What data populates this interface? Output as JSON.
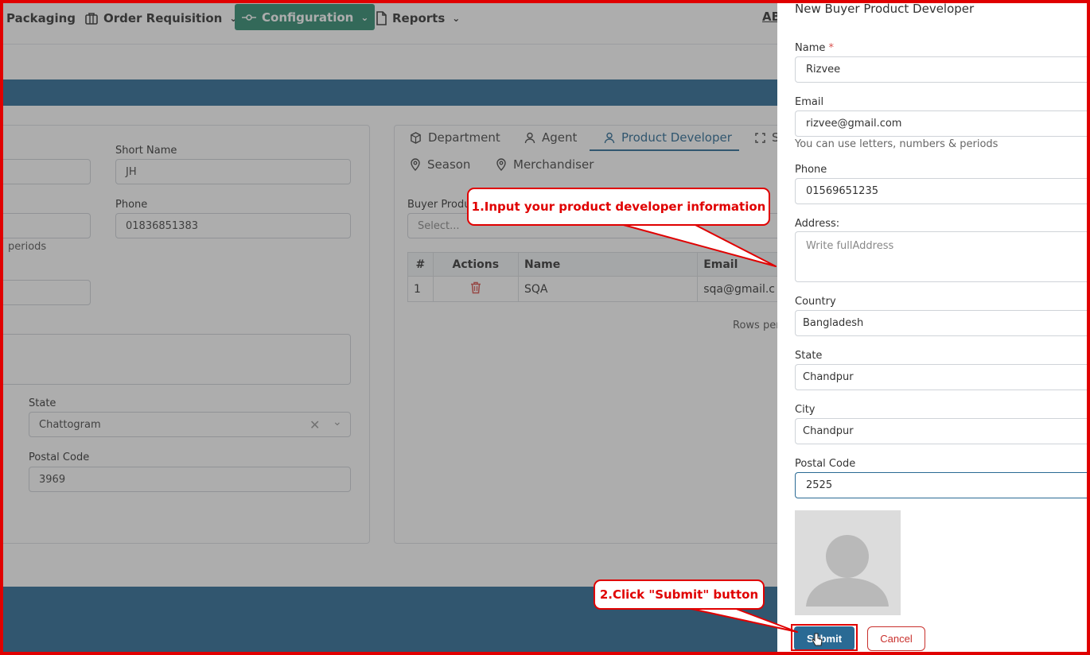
{
  "nav": {
    "items": [
      {
        "label": "Packaging"
      },
      {
        "label": "Order Requisition"
      },
      {
        "label": "Configuration"
      },
      {
        "label": "Reports"
      }
    ],
    "abbr": "AB"
  },
  "buyer_form": {
    "short_name_label": "Short Name",
    "short_name_value": "JH",
    "phone_label": "Phone",
    "phone_value": "01836851383",
    "help_fragment": "periods",
    "state_label": "State",
    "state_value": "Chattogram",
    "postal_label": "Postal Code",
    "postal_value": "3969"
  },
  "tabs": {
    "department": "Department",
    "agent": "Agent",
    "product_developer": "Product Developer",
    "fourth_partial": "S",
    "season": "Season",
    "merchandiser": "Merchandiser"
  },
  "pd_panel": {
    "select_label": "Buyer Produ",
    "select_placeholder": "Select...",
    "columns": [
      "#",
      "Actions",
      "Name",
      "Email"
    ],
    "rows": [
      {
        "num": "1",
        "name": "SQA",
        "email": "sqa@gmail.c"
      }
    ],
    "rows_per_page": "Rows per"
  },
  "drawer": {
    "title": "New Buyer Product Developer",
    "name_label": "Name",
    "name_required": "*",
    "name_value": "Rizvee",
    "email_label": "Email",
    "email_value": "rizvee@gmail.com",
    "email_help": "You can use letters, numbers & periods",
    "phone_label": "Phone",
    "phone_value": "01569651235",
    "address_label": "Address:",
    "address_placeholder": "Write fullAddress",
    "country_label": "Country",
    "country_value": "Bangladesh",
    "state_label": "State",
    "state_value": "Chandpur",
    "city_label": "City",
    "city_value": "Chandpur",
    "postal_label": "Postal Code",
    "postal_value": "2525",
    "submit": "Submit",
    "cancel": "Cancel"
  },
  "annotations": {
    "step1": "1.Input your product developer information",
    "step2": "2.Click \"Submit\" button"
  },
  "colors": {
    "primary": "#2a6a94",
    "nav_active": "#2e8b6f",
    "annotation_red": "#e00000",
    "danger": "#c9302c"
  }
}
